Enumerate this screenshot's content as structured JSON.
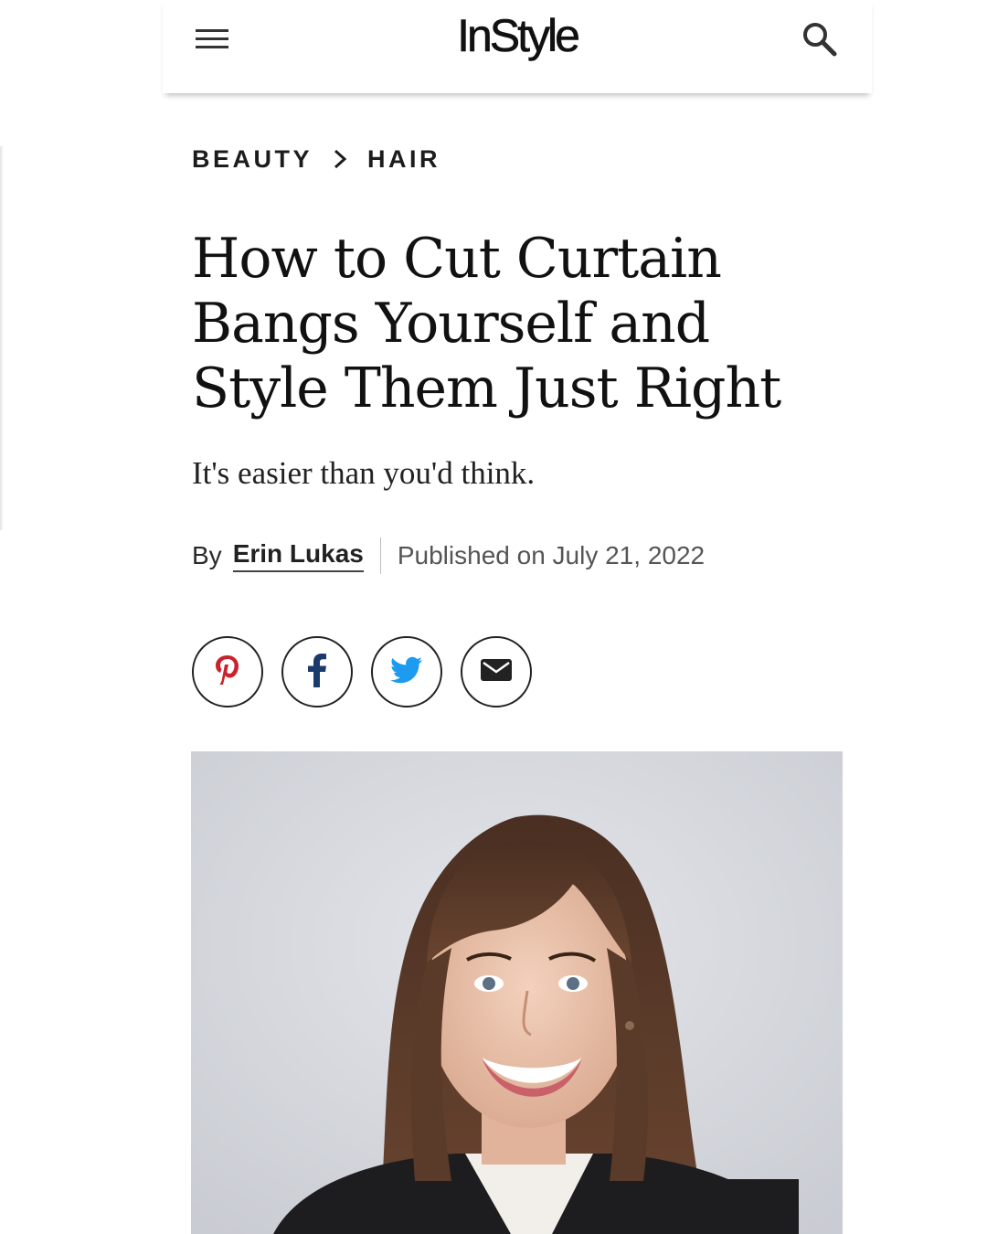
{
  "header": {
    "logo": "InStyle",
    "menu_icon": "hamburger-menu-icon",
    "search_icon": "search-icon"
  },
  "breadcrumb": {
    "items": [
      "BEAUTY",
      "HAIR"
    ],
    "separator_icon": "chevron-right-icon"
  },
  "article": {
    "headline_lines": [
      "How to Cut Curtain",
      "Bangs Yourself and",
      "Style Them Just Right"
    ],
    "dek": "It's easier than you'd think.",
    "byline_prefix": "By",
    "author": "Erin Lukas",
    "published": "Published on July 21, 2022"
  },
  "share": {
    "buttons": [
      {
        "icon": "pinterest-icon",
        "color": "#c8232c"
      },
      {
        "icon": "facebook-icon",
        "color": "#1b3a6b"
      },
      {
        "icon": "twitter-icon",
        "color": "#1d9bf0"
      },
      {
        "icon": "email-icon",
        "color": "#222222"
      }
    ]
  },
  "hero_image": {
    "subject": "photo-of-smiling-woman-with-curtain-bangs"
  },
  "colors": {
    "text": "#111111",
    "pinterest": "#c8232c",
    "facebook": "#1b3a6b",
    "twitter": "#1d9bf0"
  }
}
